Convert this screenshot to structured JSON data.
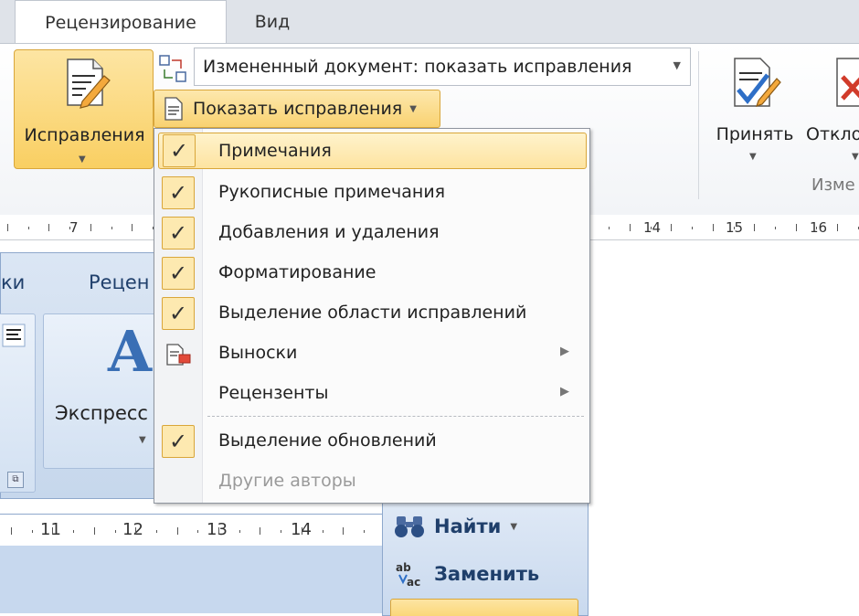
{
  "tabs": [
    {
      "label": "Рецензирование",
      "active": true
    },
    {
      "label": "Вид",
      "active": false
    }
  ],
  "ribbon": {
    "track_changes_label": "Исправления",
    "display_mode_value": "Измененный документ: показать исправления",
    "show_markup_label": "Показать исправления",
    "accept_label": "Принять",
    "reject_label": "Откло",
    "group_label": "Изме"
  },
  "ruler_top": [
    "7",
    "14",
    "15",
    "16"
  ],
  "menu": {
    "items": [
      {
        "label": "Примечания",
        "checked": true,
        "hover": true
      },
      {
        "label": "Рукописные примечания",
        "checked": true
      },
      {
        "label": "Добавления и удаления",
        "checked": true
      },
      {
        "label": "Форматирование",
        "checked": true
      },
      {
        "label": "Выделение области исправлений",
        "checked": true
      },
      {
        "label": "Выноски",
        "icon": "balloon-icon",
        "submenu": true
      },
      {
        "label": "Рецензенты",
        "submenu": true
      },
      {
        "label": "Выделение обновлений",
        "checked": true
      },
      {
        "label": "Другие авторы",
        "disabled": true
      }
    ],
    "check_glyph": "✓",
    "submenu_glyph": "▶"
  },
  "background": {
    "tab_fragment_1": "ки",
    "tab_fragment_2": "Рецен",
    "express_label": "Экспресс",
    "ruler_bottom": [
      "11",
      "12",
      "13",
      "14"
    ],
    "find_label": "Найти",
    "replace_label": "Заменить"
  },
  "colors": {
    "highlight": "#f9cf62",
    "highlight_border": "#d9a63a",
    "inner_ribbon": "#c6d7ec",
    "inner_text": "#1f3f6b"
  }
}
